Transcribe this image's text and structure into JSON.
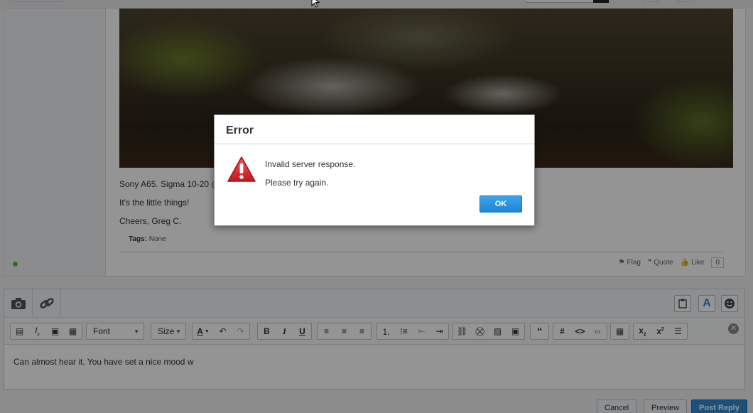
{
  "post": {
    "caption": "Sony A65. Sigma 10-20 @",
    "line2": "It's the little things!",
    "signoff": "Cheers, Greg C.",
    "tags_label": "Tags:",
    "tags_value": "None",
    "actions": {
      "flag": "Flag",
      "quote": "Quote",
      "like": "Like",
      "like_count": "0"
    }
  },
  "editor": {
    "font_label": "Font",
    "size_label": "Size",
    "body_text": "Can almost hear it. You have set a nice mood w"
  },
  "buttons": {
    "cancel": "Cancel",
    "preview": "Preview",
    "post_reply": "Post Reply"
  },
  "dialog": {
    "title": "Error",
    "message_line1": "Invalid server response.",
    "message_line2": "Please try again.",
    "ok_label": "OK"
  },
  "icons": {
    "camera": "camera-icon",
    "link": "link-icon",
    "paste": "clipboard-icon",
    "text_color": "text-color-icon",
    "emoji": "smiley-icon",
    "warning": "warning-icon"
  },
  "colors": {
    "accent": "#2f8bd8",
    "warning_red": "#d6262b",
    "online": "#4cbe35"
  }
}
